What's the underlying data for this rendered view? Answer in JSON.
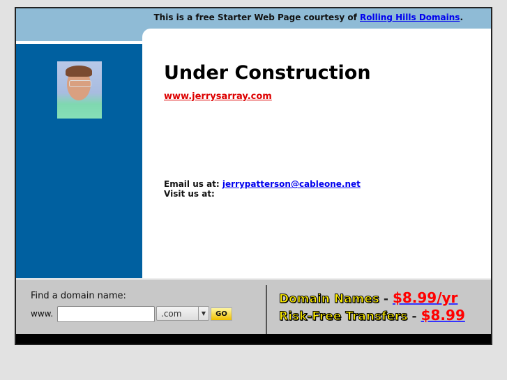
{
  "header": {
    "courtesy_text": "This is a free Starter Web Page courtesy of ",
    "courtesy_link": "Rolling Hills Domains",
    "courtesy_end": "."
  },
  "main": {
    "title": "Under Construction",
    "site_link": "www.jerrysarray.com",
    "email_label": "Email us at: ",
    "email": "jerrypatterson@cableone.net ",
    "visit_label": "Visit us at:"
  },
  "domain_search": {
    "label": "Find a domain name:",
    "prefix": "www.",
    "input_value": "",
    "tld_selected": ".com",
    "go_label": "GO"
  },
  "promos": [
    {
      "name": "Domain Names",
      "price": "$8.99/yr"
    },
    {
      "name": "Risk-Free Transfers",
      "price": "$8.99"
    }
  ],
  "colors": {
    "top_bar": "#8fbbd6",
    "left_panel": "#0060a0",
    "bottom_bar": "#c8c8c8"
  }
}
